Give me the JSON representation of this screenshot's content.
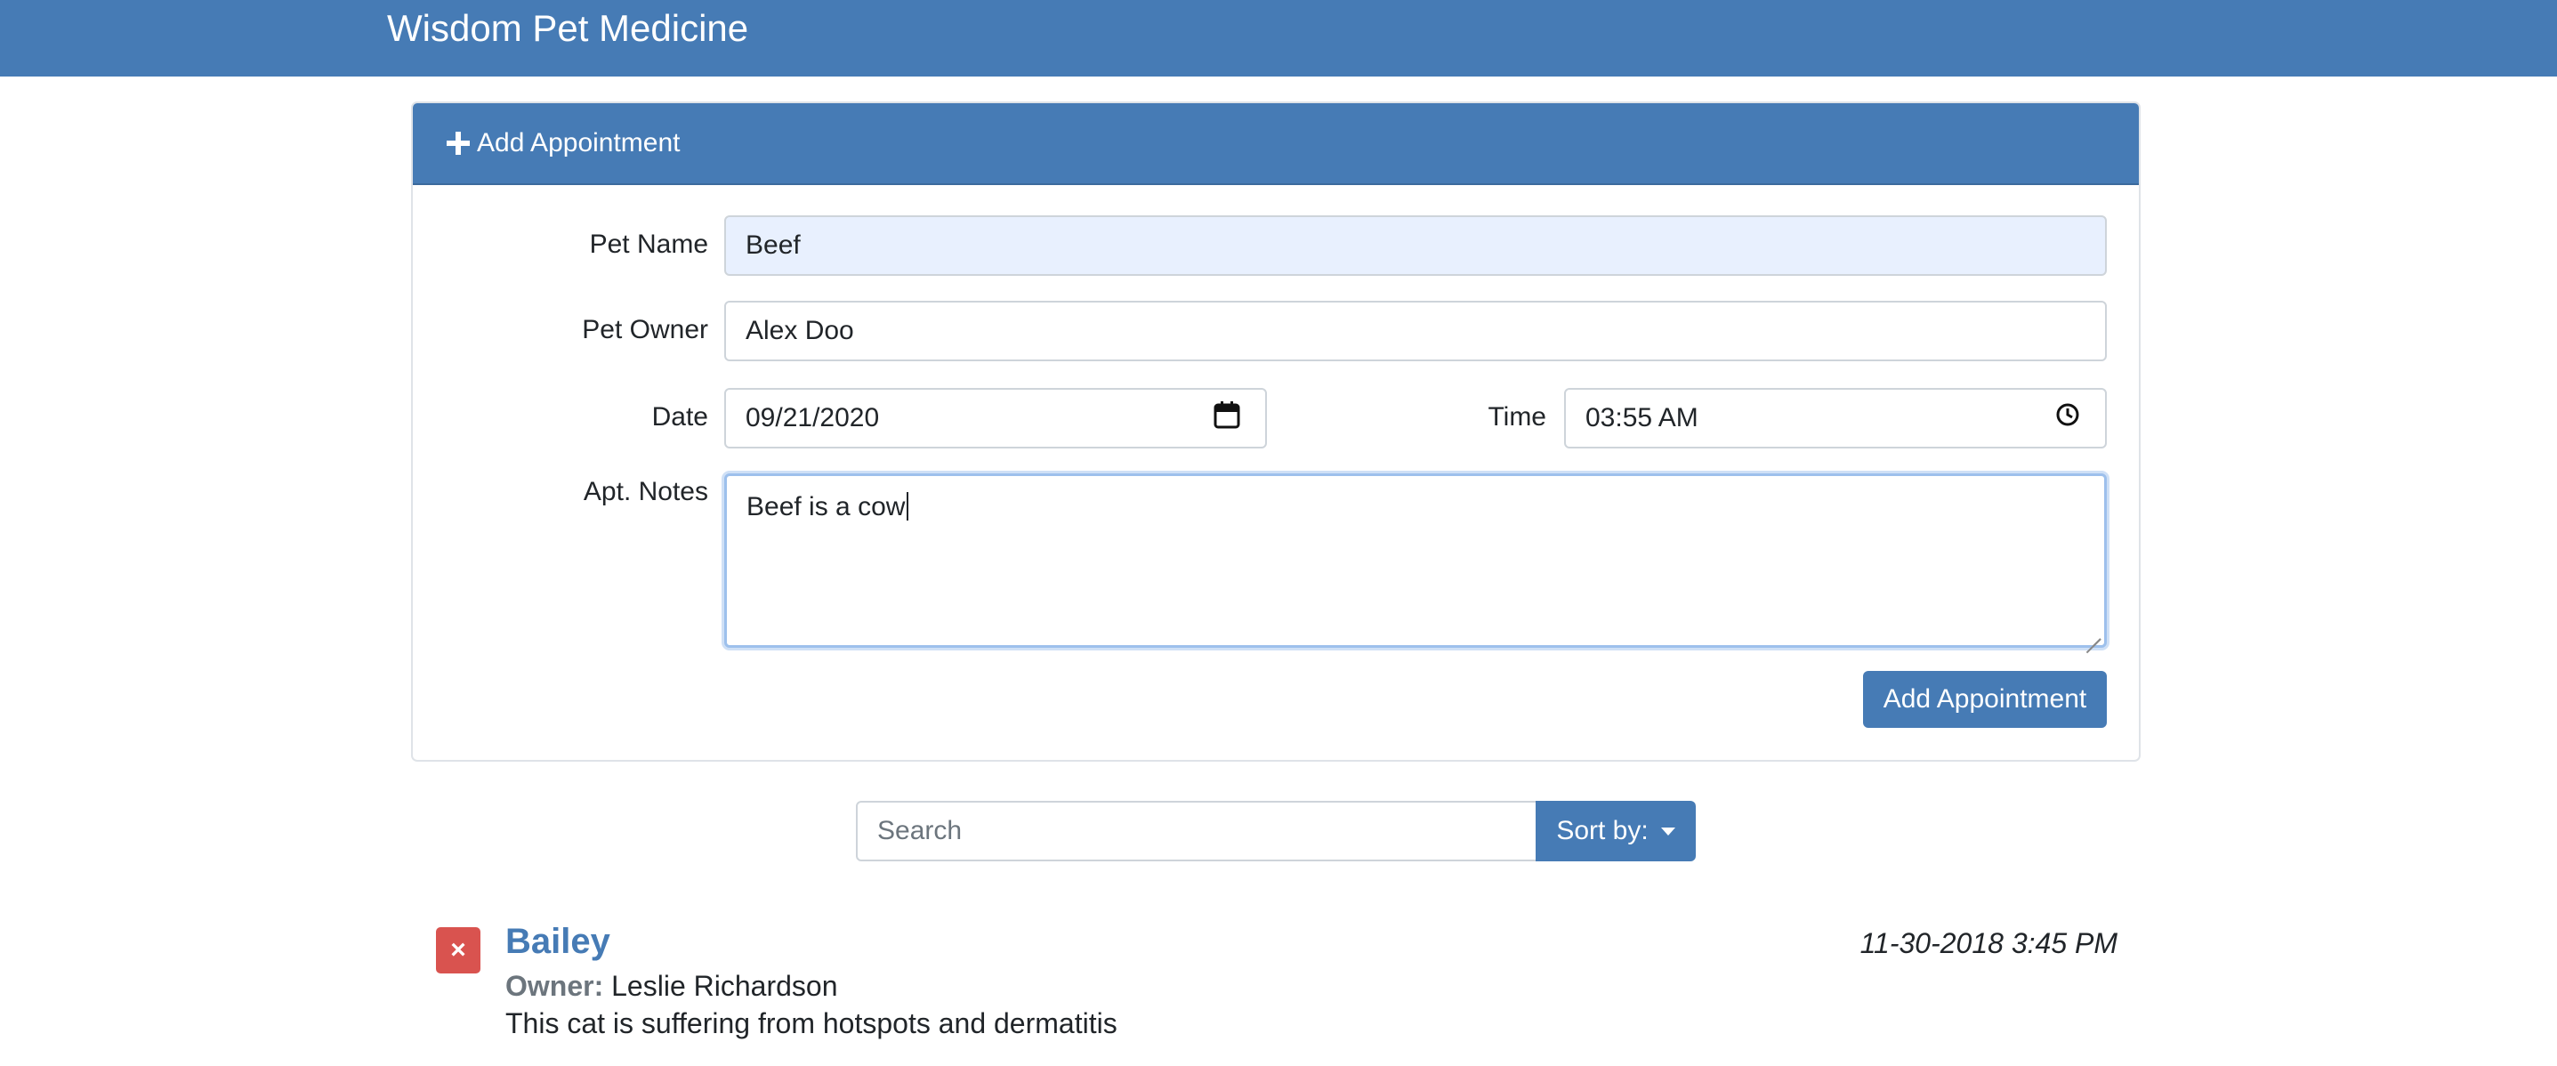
{
  "app": {
    "title": "Wisdom Pet Medicine"
  },
  "form": {
    "header_label": "Add Appointment",
    "pet_name": {
      "label": "Pet Name",
      "value": "Beef"
    },
    "pet_owner": {
      "label": "Pet Owner",
      "value": "Alex Doo"
    },
    "date": {
      "label": "Date",
      "value": "09/21/2020"
    },
    "time": {
      "label": "Time",
      "value": "03:55 AM"
    },
    "notes": {
      "label": "Apt. Notes",
      "value": "Beef is a cow"
    },
    "submit_label": "Add Appointment"
  },
  "search": {
    "placeholder": "Search",
    "sort_label": "Sort by:"
  },
  "appointments": [
    {
      "delete_icon": "×",
      "pet_name": "Bailey",
      "datetime": "11-30-2018 3:45 PM",
      "owner_label": "Owner:",
      "owner": "Leslie Richardson",
      "notes": "This cat is suffering from hotspots and dermatitis"
    }
  ],
  "colors": {
    "primary": "#467bb5",
    "danger": "#d9534f",
    "autofill_bg": "#e8f0fe"
  },
  "icons": {
    "add": "plus-icon",
    "date": "calendar-icon",
    "time": "clock-icon",
    "delete": "close-icon",
    "sort": "caret-down-icon"
  }
}
